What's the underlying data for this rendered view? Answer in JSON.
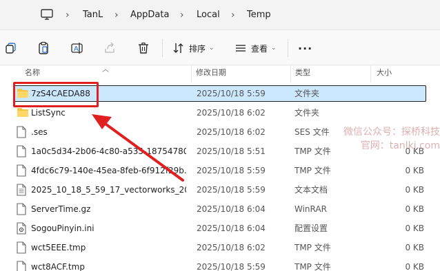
{
  "address": {
    "crumbs": [
      "TanL",
      "AppData",
      "Local",
      "Temp"
    ]
  },
  "toolbar": {
    "sort_label": "排序",
    "view_label": "查看",
    "more_label": "···"
  },
  "columns": {
    "name": "名称",
    "date": "修改日期",
    "type": "类型",
    "size": "大小"
  },
  "files": [
    {
      "name": "7zS4CAEDA88",
      "date": "2025/10/18 5:59",
      "type": "文件夹",
      "size": "",
      "icon": "folder-icon",
      "selected": true
    },
    {
      "name": "ListSync",
      "date": "2025/10/18 6:02",
      "type": "文件夹",
      "size": "",
      "icon": "folder-icon"
    },
    {
      "name": ".ses",
      "date": "2025/10/18 6:02",
      "type": "SES 文件",
      "size": "",
      "icon": "file-icon"
    },
    {
      "name": "1a0c5d34-2b06-4c80-a535-18754780...",
      "date": "2025/10/18 5:51",
      "type": "TMP 文件",
      "size": "0 KB",
      "icon": "file-icon"
    },
    {
      "name": "4fdc6c79-140e-45ea-8feb-6f912f29b...",
      "date": "2025/10/18 5:59",
      "type": "TMP 文件",
      "size": "0 KB",
      "icon": "file-icon"
    },
    {
      "name": "2025_10_18_5_59_17_vectorworks_20...",
      "date": "2025/10/18 5:59",
      "type": "文本文档",
      "size": "0 KB",
      "icon": "text-file-icon"
    },
    {
      "name": "ServerTime.gz",
      "date": "2025/10/18 6:04",
      "type": "WinRAR",
      "size": "0 KB",
      "icon": "file-icon"
    },
    {
      "name": "SogouPinyin.ini",
      "date": "2025/10/18 6:04",
      "type": "配置设置",
      "size": "0 KB",
      "icon": "ini-file-icon"
    },
    {
      "name": "wct5EEE.tmp",
      "date": "2025/10/18 6:02",
      "type": "TMP 文件",
      "size": "0 KB",
      "icon": "file-icon"
    },
    {
      "name": "wct8ACF.tmp",
      "date": "2025/10/18 5:59",
      "type": "TMP 文件",
      "size": "0 KB",
      "icon": "file-icon"
    }
  ],
  "watermark": {
    "line1": "微信公众号：探桥科技",
    "line2": "官网：tanlkj.com"
  },
  "colors": {
    "selection": "#cce8ff",
    "annotation": "#e02020",
    "folder": "#f5c342"
  }
}
